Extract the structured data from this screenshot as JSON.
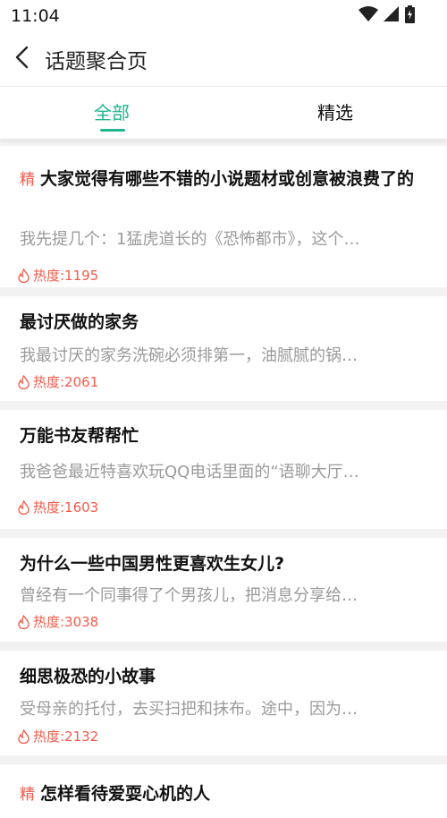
{
  "status": {
    "time": "11:04"
  },
  "header": {
    "title": "话题聚合页"
  },
  "tabs": [
    {
      "label": "全部",
      "active": true
    },
    {
      "label": "精选",
      "active": false
    }
  ],
  "items": [
    {
      "badge": "精",
      "title": "大家觉得有哪些不错的小说题材或创意被浪费了的",
      "snippet": "我先提几个：1猛虎道长的《恐怖都市》，这个…",
      "heat": "热度:1195"
    },
    {
      "badge": "",
      "title": "最讨厌做的家务",
      "snippet": "我最讨厌的家务洗碗必须排第一，油腻腻的锅…",
      "heat": "热度:2061"
    },
    {
      "badge": "",
      "title": "万能书友帮帮忙",
      "snippet": "我爸爸最近特喜欢玩QQ电话里面的“语聊大厅…",
      "heat": "热度:1603"
    },
    {
      "badge": "",
      "title": "为什么一些中国男性更喜欢生女儿?",
      "snippet": "曾经有一个同事得了个男孩儿，把消息分享给…",
      "heat": "热度:3038"
    },
    {
      "badge": "",
      "title": "细思极恐的小故事",
      "snippet": "受母亲的托付，去买扫把和抹布。途中，因为…",
      "heat": "热度:2132"
    },
    {
      "badge": "精",
      "title": "怎样看待爱耍心机的人",
      "snippet": "",
      "heat": ""
    }
  ],
  "colors": {
    "accent": "#1fb58f",
    "hot": "#f35a4a",
    "muted": "#9a9a9a"
  }
}
